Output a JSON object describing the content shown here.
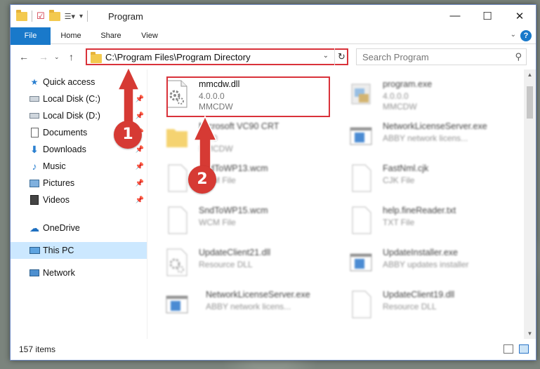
{
  "window": {
    "title": "Program",
    "controls": {
      "minimize": "—",
      "maximize": "☐",
      "close": "✕"
    }
  },
  "ribbon": {
    "tabs": [
      "File",
      "Home",
      "Share",
      "View"
    ],
    "help": "?"
  },
  "nav": {
    "address": "C:\\Program Files\\Program Directory",
    "search_placeholder": "Search Program"
  },
  "sidebar": {
    "items": [
      {
        "label": "Quick access",
        "icon": "star-icon",
        "pinned": false
      },
      {
        "label": "Local Disk (C:)",
        "icon": "drive-icon",
        "pinned": true
      },
      {
        "label": "Local Disk (D:)",
        "icon": "drive-icon",
        "pinned": true
      },
      {
        "label": "Documents",
        "icon": "documents-icon",
        "pinned": true
      },
      {
        "label": "Downloads",
        "icon": "download-icon",
        "pinned": true
      },
      {
        "label": "Music",
        "icon": "music-icon",
        "pinned": true
      },
      {
        "label": "Pictures",
        "icon": "pictures-icon",
        "pinned": true
      },
      {
        "label": "Videos",
        "icon": "videos-icon",
        "pinned": true
      },
      {
        "label": "OneDrive",
        "icon": "cloud-icon",
        "pinned": false
      },
      {
        "label": "This PC",
        "icon": "computer-icon",
        "pinned": false,
        "selected": true
      },
      {
        "label": "Network",
        "icon": "network-icon",
        "pinned": false
      }
    ]
  },
  "files": [
    {
      "name": "mmcdw.dll",
      "line1": "4.0.0.0",
      "line2": "MMCDW",
      "icon": "dll-gear-icon",
      "highlighted": true
    },
    {
      "name": "program.exe",
      "line1": "4.0.0.0",
      "line2": "MMCDW",
      "icon": "exe-icon"
    },
    {
      "name": "Microsoft VC90 CRT",
      "line1": "1.0.0",
      "line2": "MMCDW",
      "icon": "folder-icon"
    },
    {
      "name": "NetworkLicenseServer.exe",
      "line1": "ABBY network licens...",
      "line2": "",
      "icon": "app-window-icon"
    },
    {
      "name": "SndToWP13.wcm",
      "line1": "WCM File",
      "line2": "",
      "icon": "blank-file-icon"
    },
    {
      "name": "FastNml.cjk",
      "line1": "CJK File",
      "line2": "",
      "icon": "blank-file-icon"
    },
    {
      "name": "SndToWP15.wcm",
      "line1": "WCM File",
      "line2": "",
      "icon": "blank-file-icon"
    },
    {
      "name": "help.fineReader.txt",
      "line1": "TXT File",
      "line2": "",
      "icon": "blank-file-icon"
    },
    {
      "name": "UpdateClient21.dll",
      "line1": "Resource DLL",
      "line2": "",
      "icon": "dll-gear-icon"
    },
    {
      "name": "UpdateInstaller.exe",
      "line1": "ABBY updates installer",
      "line2": "",
      "icon": "app-window-icon"
    },
    {
      "name": "NetworkLicenseServer.exe",
      "line1": "ABBY network licens...",
      "line2": "",
      "icon": "app-window-icon"
    },
    {
      "name": "UpdateClient19.dll",
      "line1": "Resource DLL",
      "line2": "",
      "icon": "blank-file-icon"
    }
  ],
  "status": {
    "count": "157 items"
  },
  "annotations": {
    "badge1": "1",
    "badge2": "2"
  },
  "colors": {
    "accent": "#1979ca",
    "highlight": "#d9323a",
    "selected": "#cce8ff"
  }
}
